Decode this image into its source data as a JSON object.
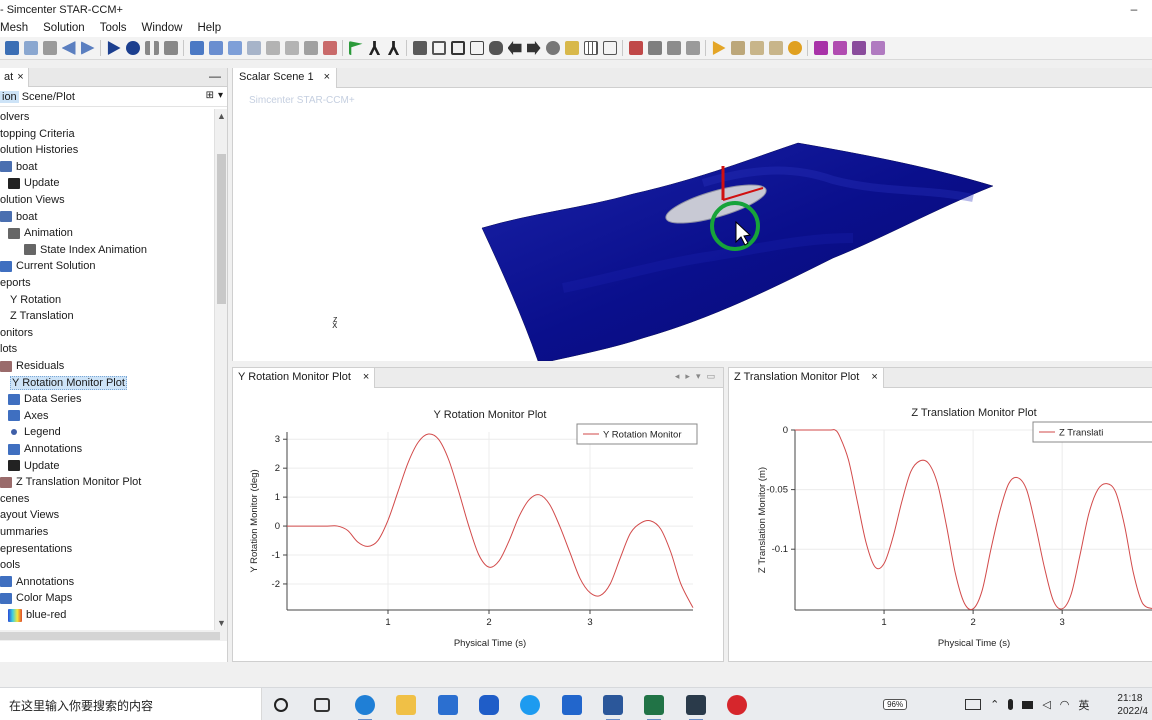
{
  "window": {
    "title": "- Simcenter STAR-CCM+",
    "min_glyph": "–",
    "max_glyph": "□",
    "close_glyph": "✕"
  },
  "menu": [
    "Mesh",
    "Solution",
    "Tools",
    "Window",
    "Help"
  ],
  "left_panel": {
    "tab_label": "at",
    "tab_close": "×",
    "minimize": "—",
    "scene_plot_prefix": "ion",
    "scene_plot_label": "Scene/Plot",
    "tree": [
      {
        "label": "olvers",
        "indent": 0,
        "icon": "none"
      },
      {
        "label": "topping Criteria",
        "indent": 0,
        "icon": "none"
      },
      {
        "label": "olution Histories",
        "indent": 0,
        "icon": "none"
      },
      {
        "label": "boat",
        "indent": 0,
        "icon": "boat"
      },
      {
        "label": "Update",
        "indent": 1,
        "icon": "run"
      },
      {
        "label": "olution Views",
        "indent": 0,
        "icon": "none"
      },
      {
        "label": "boat",
        "indent": 0,
        "icon": "boat"
      },
      {
        "label": "Animation",
        "indent": 1,
        "icon": "film"
      },
      {
        "label": "State Index Animation",
        "indent": 2,
        "icon": "film"
      },
      {
        "label": "Current Solution",
        "indent": 0,
        "icon": "folder"
      },
      {
        "label": "eports",
        "indent": 0,
        "icon": "none"
      },
      {
        "label": "Y Rotation",
        "indent": 0,
        "icon": "none"
      },
      {
        "label": "Z Translation",
        "indent": 0,
        "icon": "none"
      },
      {
        "label": "onitors",
        "indent": 0,
        "icon": "none"
      },
      {
        "label": "lots",
        "indent": 0,
        "icon": "none"
      },
      {
        "label": "Residuals",
        "indent": 0,
        "icon": "plot"
      },
      {
        "label": "Y Rotation Monitor Plot",
        "indent": 0,
        "icon": "none",
        "selected": true
      },
      {
        "label": "Data Series",
        "indent": 1,
        "icon": "folder"
      },
      {
        "label": "Axes",
        "indent": 1,
        "icon": "folder"
      },
      {
        "label": "Legend",
        "indent": 1,
        "icon": "dot"
      },
      {
        "label": "Annotations",
        "indent": 1,
        "icon": "folder"
      },
      {
        "label": "Update",
        "indent": 1,
        "icon": "run"
      },
      {
        "label": "Z Translation Monitor Plot",
        "indent": 0,
        "icon": "plot"
      },
      {
        "label": "cenes",
        "indent": 0,
        "icon": "none"
      },
      {
        "label": "ayout Views",
        "indent": 0,
        "icon": "none"
      },
      {
        "label": "ummaries",
        "indent": 0,
        "icon": "none"
      },
      {
        "label": "epresentations",
        "indent": 0,
        "icon": "none"
      },
      {
        "label": "ools",
        "indent": 0,
        "icon": "none"
      },
      {
        "label": "Annotations",
        "indent": 0,
        "icon": "folder"
      },
      {
        "label": "Color Maps",
        "indent": 0,
        "icon": "folder"
      },
      {
        "label": "blue-red",
        "indent": 1,
        "icon": "colormap"
      }
    ]
  },
  "scene": {
    "tab_label": "Scalar Scene 1",
    "tab_close": "×",
    "watermark": "Simcenter STAR-CCM+",
    "axis_z": "z",
    "axis_x": "x",
    "surface_color": "#0a0f8c"
  },
  "plots": [
    {
      "tab_label": "Y Rotation Monitor Plot",
      "tab_close": "×",
      "nav": [
        "◂",
        "▸",
        "▾",
        "▭"
      ],
      "chart_data": {
        "type": "line",
        "title": "Y Rotation Monitor Plot",
        "xlabel": "Physical Time (s)",
        "ylabel": "Y Rotation Monitor (deg)",
        "xlim": [
          0,
          4.02
        ],
        "ylim": [
          -2.9,
          3.25
        ],
        "xticks": [
          1,
          2,
          3
        ],
        "yticks": [
          -2,
          -1,
          0,
          1,
          2,
          3
        ],
        "legend": "top-right",
        "grid": true,
        "series": [
          {
            "name": "Y Rotation Monitor",
            "color": "#d24a4a",
            "x": [
              0,
              0.2,
              0.4,
              0.5,
              0.6,
              0.7,
              0.8,
              0.9,
              1.0,
              1.1,
              1.2,
              1.3,
              1.4,
              1.5,
              1.6,
              1.7,
              1.8,
              1.9,
              2.0,
              2.1,
              2.2,
              2.3,
              2.4,
              2.5,
              2.6,
              2.7,
              2.8,
              2.9,
              3.0,
              3.1,
              3.2,
              3.3,
              3.4,
              3.5,
              3.6,
              3.7,
              3.8,
              3.9,
              4.02
            ],
            "y": [
              0,
              0,
              0,
              0,
              -0.15,
              -0.55,
              -0.7,
              -0.5,
              0.2,
              1.2,
              2.2,
              2.9,
              3.18,
              3.0,
              2.3,
              1.2,
              0.0,
              -1.0,
              -1.42,
              -1.2,
              -0.5,
              0.35,
              0.92,
              1.08,
              0.75,
              0.0,
              -0.9,
              -1.8,
              -2.3,
              -2.4,
              -2.0,
              -1.1,
              -0.25,
              0.1,
              0.18,
              -0.1,
              -0.9,
              -2.0,
              -2.82
            ]
          }
        ]
      }
    },
    {
      "tab_label": "Z Translation Monitor Plot",
      "tab_close": "×",
      "chart_data": {
        "type": "line",
        "title": "Z Translation Monitor Plot",
        "xlabel": "Physical Time (s)",
        "ylabel": "Z Translation Monitor (m)",
        "xlim": [
          0,
          4.02
        ],
        "ylim": [
          -0.151,
          0.0
        ],
        "xticks": [
          1,
          2,
          3
        ],
        "yticks": [
          0,
          -0.05,
          -0.1
        ],
        "ytick_labels": [
          "0",
          "-0.05",
          "-0.1"
        ],
        "legend": "top-right",
        "legend_text": "Z Translati",
        "grid": true,
        "series": [
          {
            "name": "Z Translati",
            "color": "#d24a4a",
            "x": [
              0,
              0.2,
              0.4,
              0.45,
              0.5,
              0.6,
              0.7,
              0.8,
              0.9,
              1.0,
              1.1,
              1.2,
              1.3,
              1.4,
              1.5,
              1.6,
              1.7,
              1.8,
              1.9,
              2.0,
              2.1,
              2.2,
              2.3,
              2.4,
              2.5,
              2.6,
              2.7,
              2.8,
              2.9,
              3.0,
              3.1,
              3.2,
              3.3,
              3.4,
              3.5,
              3.6,
              3.7,
              3.8,
              3.9,
              4.02
            ],
            "y": [
              0,
              0,
              0,
              0,
              -0.005,
              -0.025,
              -0.06,
              -0.095,
              -0.115,
              -0.112,
              -0.09,
              -0.06,
              -0.035,
              -0.026,
              -0.028,
              -0.045,
              -0.08,
              -0.12,
              -0.145,
              -0.15,
              -0.135,
              -0.1,
              -0.068,
              -0.045,
              -0.04,
              -0.05,
              -0.08,
              -0.115,
              -0.143,
              -0.15,
              -0.138,
              -0.105,
              -0.07,
              -0.05,
              -0.045,
              -0.052,
              -0.08,
              -0.12,
              -0.145,
              -0.15
            ]
          }
        ]
      }
    }
  ],
  "taskbar": {
    "search_placeholder": "在这里输入你要搜索的内容",
    "battery": "96%",
    "ime": "英",
    "time": "21:18",
    "date": "2022/4",
    "apps": [
      "start-ring",
      "task-view",
      "edge",
      "explorer",
      "mail",
      "lenovo",
      "browser-e",
      "photos",
      "word",
      "excel",
      "starccm",
      "netease-music"
    ]
  }
}
